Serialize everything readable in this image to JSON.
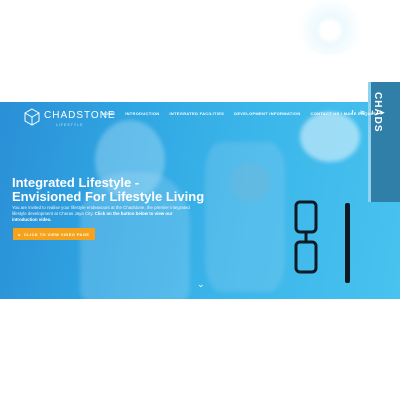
{
  "brand": {
    "name": "CHADSTONE",
    "tagline": "LIFESTYLE"
  },
  "nav": {
    "items": [
      "HOME",
      "INTRODUCTION",
      "INTEGRATED FACILITIES",
      "DEVELOPMENT INFORMATION",
      "CONTACT US / MAKE ENQUIRY"
    ]
  },
  "social": {
    "icons": [
      "facebook-icon",
      "linkedin-icon",
      "twitter-icon",
      "youtube-icon"
    ],
    "glyphs": [
      "f",
      "in",
      "t",
      "▶"
    ]
  },
  "hero": {
    "title_line1": "Integrated Lifestyle -",
    "title_line2": "Envisioned For Lifestyle Living",
    "desc_plain": "You are invited to realise your lifestyle endeavours at the Chadstone, the premier integrated lifestyle development at Cheras Jaya City. ",
    "desc_bold": "Click on the button below to view our introduction video.",
    "cta_label": "CLICK TO VIEW VIDEO PAGE",
    "cta_icon": "▸"
  },
  "scroll": {
    "icon": "chevron-down-icon",
    "glyph": "⌄"
  },
  "decor": {
    "book_text": "CHADS"
  },
  "colors": {
    "hero_overlay": "#2fa5e2",
    "cta": "#f7a21b",
    "text": "#ffffff"
  }
}
